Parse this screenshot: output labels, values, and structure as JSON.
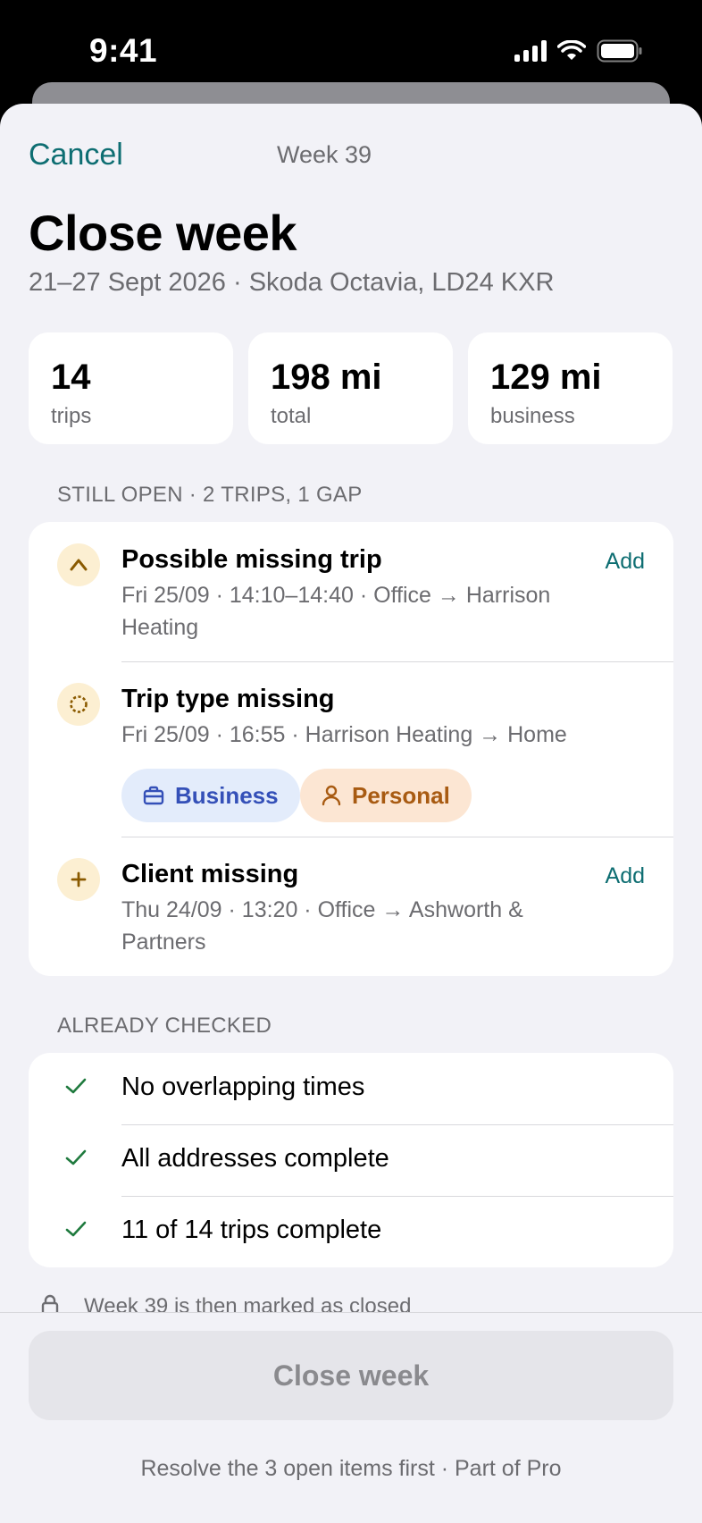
{
  "status_bar": {
    "time": "9:41"
  },
  "nav": {
    "cancel_label": "Cancel",
    "title": "Week 39"
  },
  "header": {
    "title": "Close week",
    "subtitle": "21–27 Sept 2026 · Skoda Octavia, LD24 KXR"
  },
  "stats": [
    {
      "value": "14",
      "label": "trips"
    },
    {
      "value": "198 mi",
      "label": "total"
    },
    {
      "value": "129 mi",
      "label": "business"
    }
  ],
  "open_section": {
    "header": "STILL OPEN · 2 TRIPS, 1 GAP",
    "items": [
      {
        "icon": "caret-up-icon",
        "title": "Possible missing trip",
        "detail": "Fri 25/09 · 14:10–14:40 · Office → Harrison Heating",
        "action": "Add"
      },
      {
        "icon": "dotted-circle-icon",
        "title": "Trip type missing",
        "detail": "Fri 25/09 · 16:55 · Harrison Heating → Home",
        "chips": [
          {
            "label": "Business",
            "icon": "briefcase-icon"
          },
          {
            "label": "Personal",
            "icon": "person-icon"
          }
        ]
      },
      {
        "icon": "plus-icon",
        "title": "Client missing",
        "detail": "Thu 24/09 · 13:20 · Office → Ashworth & Partners",
        "action": "Add"
      }
    ]
  },
  "checked_section": {
    "header": "ALREADY CHECKED",
    "items": [
      {
        "label": "No overlapping times"
      },
      {
        "label": "All addresses complete"
      },
      {
        "label": "11 of 14 trips complete"
      }
    ]
  },
  "footer": {
    "peek_text": "Week 39 is then marked as closed",
    "button_label": "Close week",
    "note": "Resolve the 3 open items first · Part of Pro"
  },
  "colors": {
    "accent": "#0e6e72",
    "warning_bg": "#fcefd2",
    "warning_fg": "#8a5a00",
    "success": "#1f7a3e",
    "business_bg": "#e3ecfb",
    "business_fg": "#3450b8",
    "personal_bg": "#fce6d3",
    "personal_fg": "#a85b12"
  }
}
